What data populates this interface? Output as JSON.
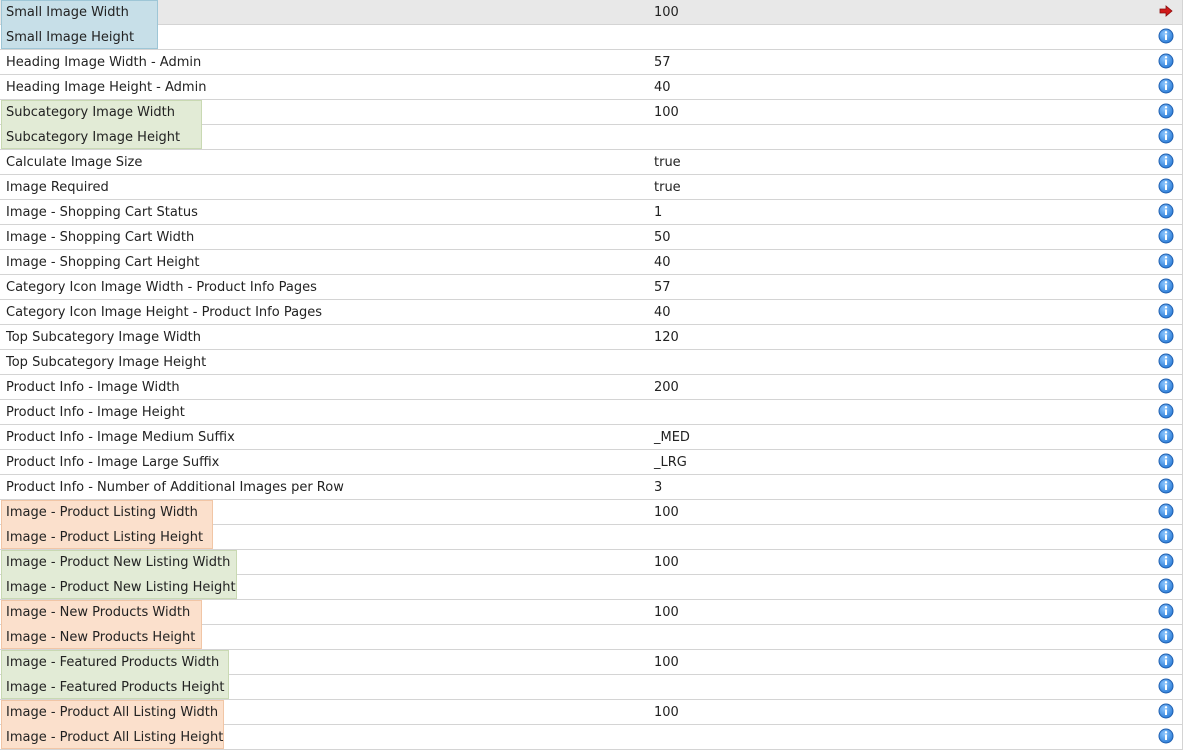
{
  "colors": {
    "highlight_blue": "#c7dfe8",
    "highlight_green": "#e2ebd6",
    "highlight_orange": "#fbe0cc",
    "info_icon_blue": "#2f7fd8",
    "arrow_red": "#d11a1a"
  },
  "icons": {
    "selected": "arrow-right-icon",
    "info": "info-icon"
  },
  "rows": [
    {
      "title": "Small Image Width",
      "value": "100",
      "highlight": "blue",
      "hlw": 157,
      "selected": true
    },
    {
      "title": "Small Image Height",
      "value": "",
      "highlight": "blue",
      "hlw": 157
    },
    {
      "title": "Heading Image Width - Admin",
      "value": "57"
    },
    {
      "title": "Heading Image Height - Admin",
      "value": "40"
    },
    {
      "title": "Subcategory Image Width",
      "value": "100",
      "highlight": "green",
      "hlw": 201
    },
    {
      "title": "Subcategory Image Height",
      "value": "",
      "highlight": "green",
      "hlw": 201
    },
    {
      "title": "Calculate Image Size",
      "value": "true"
    },
    {
      "title": "Image Required",
      "value": "true"
    },
    {
      "title": "Image - Shopping Cart Status",
      "value": "1"
    },
    {
      "title": "Image - Shopping Cart Width",
      "value": "50"
    },
    {
      "title": "Image - Shopping Cart Height",
      "value": "40"
    },
    {
      "title": "Category Icon Image Width - Product Info Pages",
      "value": "57"
    },
    {
      "title": "Category Icon Image Height - Product Info Pages",
      "value": "40"
    },
    {
      "title": "Top Subcategory Image Width",
      "value": "120"
    },
    {
      "title": "Top Subcategory Image Height",
      "value": ""
    },
    {
      "title": "Product Info - Image Width",
      "value": "200"
    },
    {
      "title": "Product Info - Image Height",
      "value": ""
    },
    {
      "title": "Product Info - Image Medium Suffix",
      "value": "_MED"
    },
    {
      "title": "Product Info - Image Large Suffix",
      "value": "_LRG"
    },
    {
      "title": "Product Info - Number of Additional Images per Row",
      "value": "3"
    },
    {
      "title": "Image - Product Listing Width",
      "value": "100",
      "highlight": "orange",
      "hlw": 212
    },
    {
      "title": "Image - Product Listing Height",
      "value": "",
      "highlight": "orange",
      "hlw": 212
    },
    {
      "title": "Image - Product New Listing Width",
      "value": "100",
      "highlight": "green",
      "hlw": 236
    },
    {
      "title": "Image - Product New Listing Height",
      "value": "",
      "highlight": "green",
      "hlw": 236
    },
    {
      "title": "Image - New Products Width",
      "value": "100",
      "highlight": "orange",
      "hlw": 201
    },
    {
      "title": "Image - New Products Height",
      "value": "",
      "highlight": "orange",
      "hlw": 201
    },
    {
      "title": "Image - Featured Products Width",
      "value": "100",
      "highlight": "green",
      "hlw": 228
    },
    {
      "title": "Image - Featured Products Height",
      "value": "",
      "highlight": "green",
      "hlw": 228
    },
    {
      "title": "Image - Product All Listing Width",
      "value": "100",
      "highlight": "orange",
      "hlw": 223
    },
    {
      "title": "Image - Product All Listing Height",
      "value": "",
      "highlight": "orange",
      "hlw": 223
    }
  ]
}
